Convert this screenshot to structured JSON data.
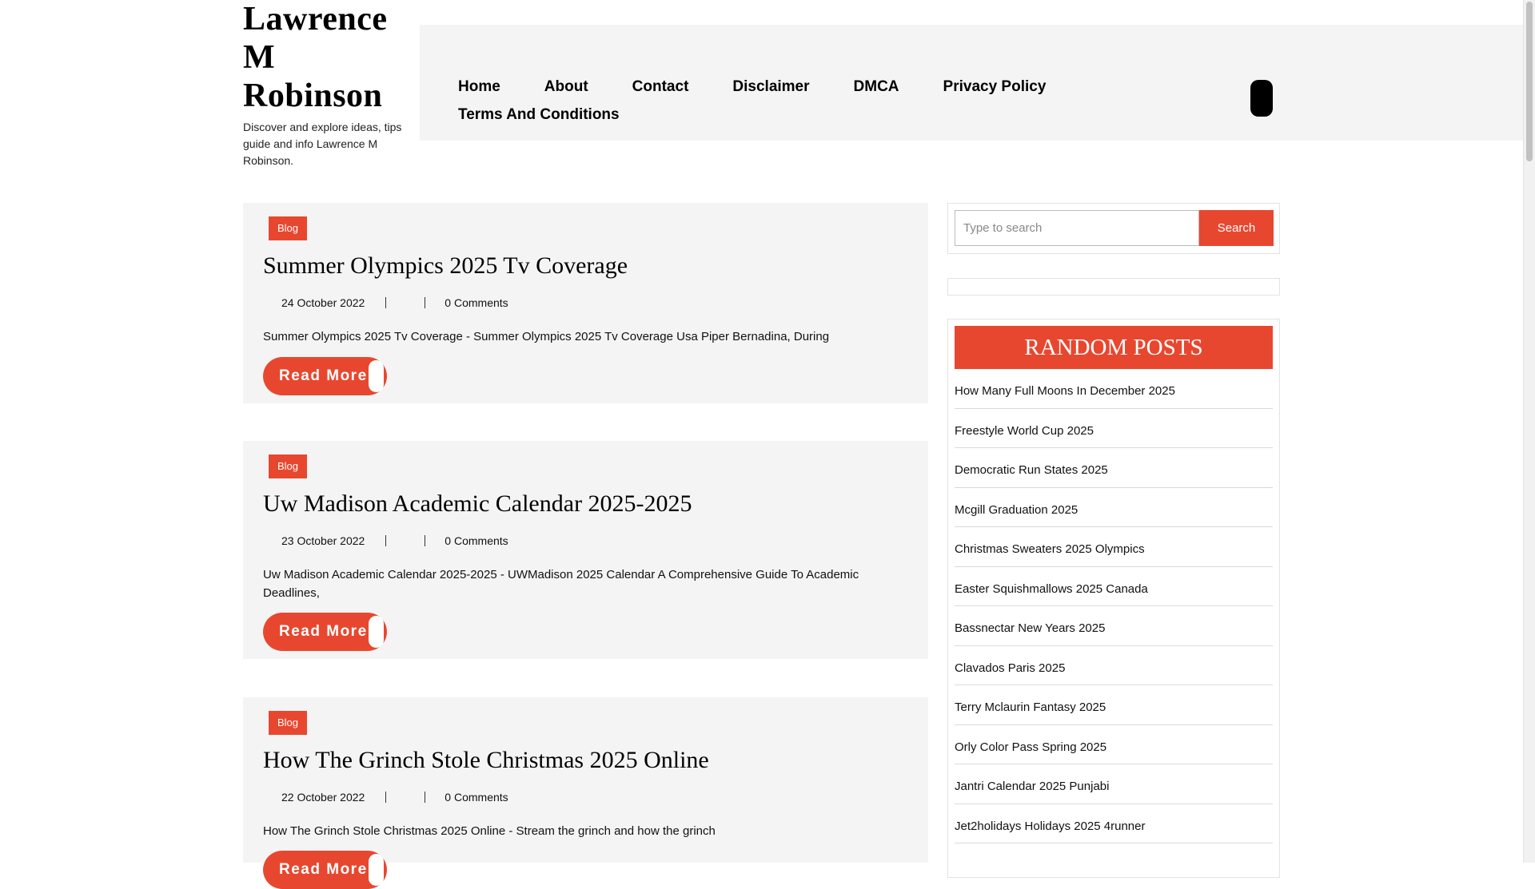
{
  "site": {
    "title_lines": [
      "Lawrence",
      "M",
      "Robinson"
    ],
    "tagline": "Discover and explore ideas, tips guide and info Lawrence M Robinson."
  },
  "nav": {
    "row1": [
      "Home",
      "About",
      "Contact",
      "Disclaimer",
      "DMCA",
      "Privacy Policy"
    ],
    "row2": [
      "Terms And Conditions"
    ]
  },
  "posts": [
    {
      "category": "Blog",
      "title": "Summer Olympics 2025 Tv Coverage",
      "date": "24 October 2022",
      "comments": "0 Comments",
      "excerpt": "Summer Olympics 2025 Tv Coverage - Summer Olympics 2025 Tv Coverage Usa Piper Bernadina, During",
      "read_more": "Read More"
    },
    {
      "category": "Blog",
      "title": "Uw Madison Academic Calendar 2025-2025",
      "date": "23 October 2022",
      "comments": "0 Comments",
      "excerpt": "Uw Madison Academic Calendar 2025-2025 - UWMadison 2025 Calendar A Comprehensive Guide To Academic Deadlines,",
      "read_more": "Read More"
    },
    {
      "category": "Blog",
      "title": "How The Grinch Stole Christmas 2025 Online",
      "date": "22 October 2022",
      "comments": "0 Comments",
      "excerpt": "How The Grinch Stole Christmas 2025 Online - Stream the grinch and how the grinch",
      "read_more": "Read More"
    }
  ],
  "search": {
    "placeholder": "Type to search",
    "button": "Search"
  },
  "random_posts": {
    "heading": "RANDOM POSTS",
    "items": [
      "How Many Full Moons In December 2025",
      "Freestyle World Cup 2025",
      "Democratic Run States 2025",
      "Mcgill Graduation 2025",
      "Christmas Sweaters 2025 Olympics",
      "Easter Squishmallows 2025 Canada",
      "Bassnectar New Years 2025",
      "Clavados Paris 2025",
      "Terry Mclaurin Fantasy 2025",
      "Orly Color Pass Spring 2025",
      "Jantri Calendar 2025 Punjabi",
      "Jet2holidays Holidays 2025 4runner"
    ]
  },
  "colors": {
    "accent": "#e8472f",
    "panel": "#f4f4f4"
  }
}
